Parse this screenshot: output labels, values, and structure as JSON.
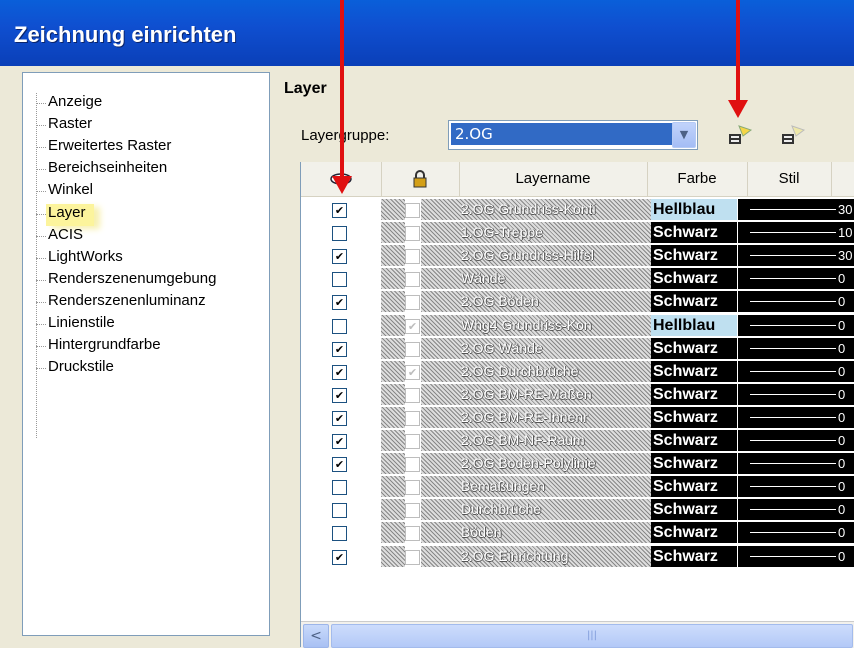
{
  "window": {
    "title": "Zeichnung einrichten"
  },
  "tree": {
    "items": [
      "Anzeige",
      "Raster",
      "Erweitertes Raster",
      "Bereichseinheiten",
      "Winkel",
      "Layer",
      "ACIS",
      "LightWorks",
      "Renderszenenumgebung",
      "Renderszenenluminanz",
      "Linienstile",
      "Hintergrundfarbe",
      "Druckstile"
    ],
    "selected": "Layer"
  },
  "panel": {
    "title": "Layer",
    "group_label": "Layergruppe:",
    "group_value": "2.OG",
    "icons": [
      "layer-add-icon",
      "layer-remove-icon"
    ],
    "columns": [
      "",
      "",
      "Layername",
      "Farbe",
      "Stil"
    ],
    "column_icons": [
      "visibility-icon",
      "lock-icon"
    ],
    "rows": [
      {
        "visible": true,
        "locked": false,
        "name": "2.OG Grundriss-Konti",
        "color": "Hellblau",
        "style": "30"
      },
      {
        "visible": false,
        "locked": false,
        "name": "1.OG-Treppe",
        "color": "Schwarz",
        "style": "10"
      },
      {
        "visible": true,
        "locked": false,
        "name": "2.OG Grundriss-Hilfsl",
        "color": "Schwarz",
        "style": "30"
      },
      {
        "visible": false,
        "locked": false,
        "name": "Wände",
        "color": "Schwarz",
        "style": "0"
      },
      {
        "visible": true,
        "locked": false,
        "name": "2.OG Böden",
        "color": "Schwarz",
        "style": "0"
      },
      {
        "visible": false,
        "locked": true,
        "name": "Whg4 Grundriss-Kon",
        "color": "Hellblau",
        "style": "0"
      },
      {
        "visible": true,
        "locked": false,
        "name": "2.OG Wände",
        "color": "Schwarz",
        "style": "0"
      },
      {
        "visible": true,
        "locked": true,
        "name": "2.OG Durchbrüche",
        "color": "Schwarz",
        "style": "0"
      },
      {
        "visible": true,
        "locked": false,
        "name": "2.OG BM-RE-Maßen",
        "color": "Schwarz",
        "style": "0"
      },
      {
        "visible": true,
        "locked": false,
        "name": "2.OG BM-RE-Innenr",
        "color": "Schwarz",
        "style": "0"
      },
      {
        "visible": true,
        "locked": false,
        "name": "2.OG BM-NF-Raum",
        "color": "Schwarz",
        "style": "0"
      },
      {
        "visible": true,
        "locked": false,
        "name": "2.OG Boden-Polylinie",
        "color": "Schwarz",
        "style": "0"
      },
      {
        "visible": false,
        "locked": false,
        "name": "Bemaßungen",
        "color": "Schwarz",
        "style": "0"
      },
      {
        "visible": false,
        "locked": false,
        "name": "Durchbrüche",
        "color": "Schwarz",
        "style": "0"
      },
      {
        "visible": false,
        "locked": false,
        "name": "Böden",
        "color": "Schwarz",
        "style": "0"
      },
      {
        "visible": true,
        "locked": false,
        "name": "2.OG Einrichtung",
        "color": "Schwarz",
        "style": "0"
      }
    ],
    "colors": {
      "accent": "#316AC5",
      "annotation": "#E01010",
      "highlight": "#FCF49C"
    }
  }
}
